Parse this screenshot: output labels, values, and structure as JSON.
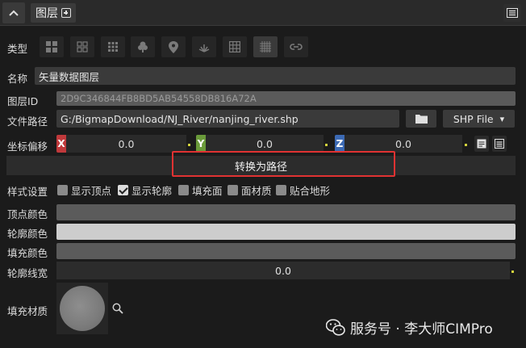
{
  "header": {
    "title": "图层"
  },
  "type_row": {
    "label": "类型"
  },
  "name_row": {
    "label": "名称",
    "value": "矢量数据图层"
  },
  "layer_id_row": {
    "label": "图层ID",
    "value": "2D9C346844FB8BD5AB54558DB816A72A"
  },
  "file_path_row": {
    "label": "文件路径",
    "value": "G:/BigmapDownload/NJ_River/nanjing_river.shp",
    "file_type": "SHP File",
    "file_type_arrow": "▾"
  },
  "offset_row": {
    "label": "坐标偏移",
    "x_tag": "X",
    "x_value": "0.0",
    "y_tag": "Y",
    "y_value": "0.0",
    "z_tag": "Z",
    "z_value": "0.0"
  },
  "convert_button": {
    "label": "转换为路径"
  },
  "style_row": {
    "label": "样式设置",
    "options": [
      {
        "label": "显示顶点",
        "checked": false
      },
      {
        "label": "显示轮廓",
        "checked": true
      },
      {
        "label": "填充面",
        "checked": false
      },
      {
        "label": "面材质",
        "checked": false
      },
      {
        "label": "贴合地形",
        "checked": false
      }
    ]
  },
  "vertex_color_row": {
    "label": "顶点颜色",
    "color": "#5b5b5b"
  },
  "outline_color_row": {
    "label": "轮廓颜色",
    "color": "#cdcdcd"
  },
  "fill_color_row": {
    "label": "填充颜色",
    "color": "#5b5b5b"
  },
  "outline_width_row": {
    "label": "轮廓线宽",
    "value": "0.0"
  },
  "fill_material_row": {
    "label": "填充材质"
  },
  "watermark": {
    "text": "服务号 · 李大师CIMPro"
  },
  "colors": {
    "x_axis": "#c0393b",
    "y_axis": "#6a9a3a",
    "z_axis": "#3c6ab4",
    "highlight": "#e03232"
  }
}
